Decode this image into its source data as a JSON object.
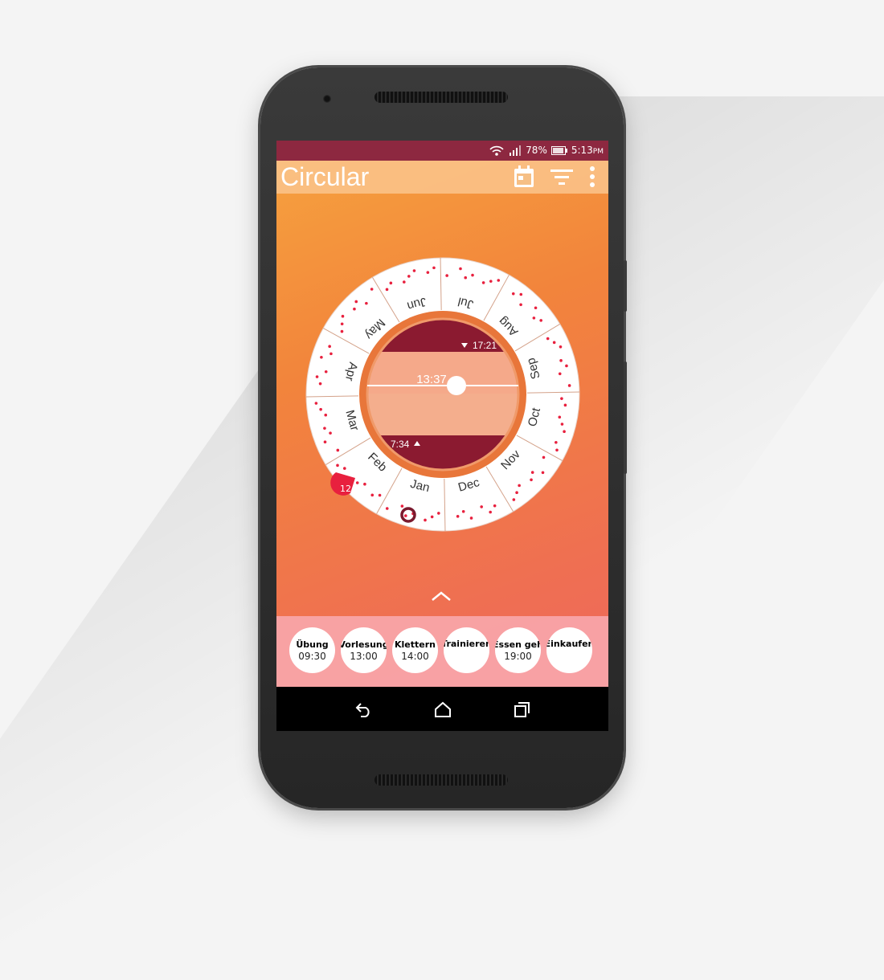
{
  "status_bar": {
    "battery": "78%",
    "time": "5:13",
    "ampm": "PM",
    "icons": [
      "wifi-icon",
      "signal-icon",
      "battery-icon"
    ]
  },
  "app_bar": {
    "title": "Circular",
    "icons": [
      "calendar-icon",
      "filter-icon",
      "overflow-menu-icon"
    ]
  },
  "dial": {
    "months": [
      "Jan",
      "Feb",
      "Mar",
      "Apr",
      "May",
      "Jun",
      "Jul",
      "Aug",
      "Sep",
      "Oct",
      "Nov",
      "Dec"
    ],
    "current_time": "13:37",
    "sunset": "17:21",
    "sunrise": "7:34",
    "badge": "12",
    "colors": {
      "night": "#8b1a30",
      "day": "#f5a98a",
      "ring": "#e8763a",
      "dots": "#e8203e"
    }
  },
  "events": [
    {
      "name": "Übung",
      "time": "09:30"
    },
    {
      "name": "Vorlesung",
      "time": "13:00"
    },
    {
      "name": "Klettern",
      "time": "14:00"
    },
    {
      "name": "Trainieren",
      "time": ""
    },
    {
      "name": "Essen geh",
      "time": "19:00"
    },
    {
      "name": "Einkaufen",
      "time": ""
    }
  ],
  "nav": {
    "icons": [
      "back-icon",
      "home-icon",
      "recents-icon"
    ]
  }
}
